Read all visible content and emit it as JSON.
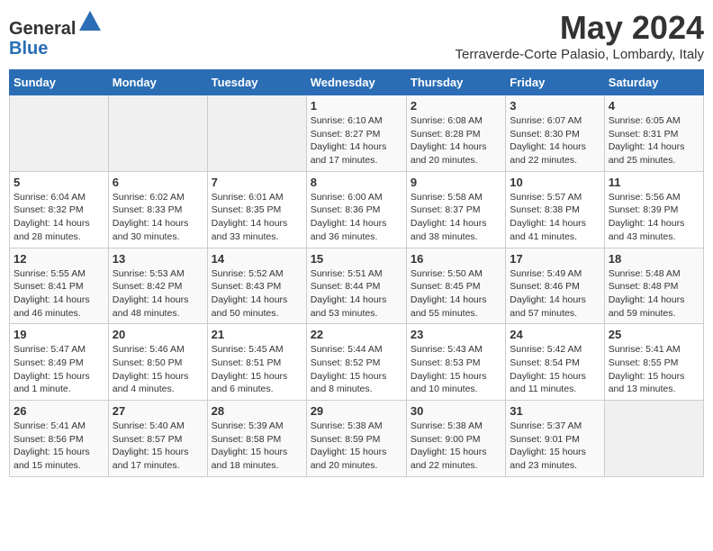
{
  "header": {
    "logo_line1": "General",
    "logo_line2": "Blue",
    "month_title": "May 2024",
    "subtitle": "Terraverde-Corte Palasio, Lombardy, Italy"
  },
  "weekdays": [
    "Sunday",
    "Monday",
    "Tuesday",
    "Wednesday",
    "Thursday",
    "Friday",
    "Saturday"
  ],
  "weeks": [
    [
      {
        "day": "",
        "info": ""
      },
      {
        "day": "",
        "info": ""
      },
      {
        "day": "",
        "info": ""
      },
      {
        "day": "1",
        "info": "Sunrise: 6:10 AM\nSunset: 8:27 PM\nDaylight: 14 hours and 17 minutes."
      },
      {
        "day": "2",
        "info": "Sunrise: 6:08 AM\nSunset: 8:28 PM\nDaylight: 14 hours and 20 minutes."
      },
      {
        "day": "3",
        "info": "Sunrise: 6:07 AM\nSunset: 8:30 PM\nDaylight: 14 hours and 22 minutes."
      },
      {
        "day": "4",
        "info": "Sunrise: 6:05 AM\nSunset: 8:31 PM\nDaylight: 14 hours and 25 minutes."
      }
    ],
    [
      {
        "day": "5",
        "info": "Sunrise: 6:04 AM\nSunset: 8:32 PM\nDaylight: 14 hours and 28 minutes."
      },
      {
        "day": "6",
        "info": "Sunrise: 6:02 AM\nSunset: 8:33 PM\nDaylight: 14 hours and 30 minutes."
      },
      {
        "day": "7",
        "info": "Sunrise: 6:01 AM\nSunset: 8:35 PM\nDaylight: 14 hours and 33 minutes."
      },
      {
        "day": "8",
        "info": "Sunrise: 6:00 AM\nSunset: 8:36 PM\nDaylight: 14 hours and 36 minutes."
      },
      {
        "day": "9",
        "info": "Sunrise: 5:58 AM\nSunset: 8:37 PM\nDaylight: 14 hours and 38 minutes."
      },
      {
        "day": "10",
        "info": "Sunrise: 5:57 AM\nSunset: 8:38 PM\nDaylight: 14 hours and 41 minutes."
      },
      {
        "day": "11",
        "info": "Sunrise: 5:56 AM\nSunset: 8:39 PM\nDaylight: 14 hours and 43 minutes."
      }
    ],
    [
      {
        "day": "12",
        "info": "Sunrise: 5:55 AM\nSunset: 8:41 PM\nDaylight: 14 hours and 46 minutes."
      },
      {
        "day": "13",
        "info": "Sunrise: 5:53 AM\nSunset: 8:42 PM\nDaylight: 14 hours and 48 minutes."
      },
      {
        "day": "14",
        "info": "Sunrise: 5:52 AM\nSunset: 8:43 PM\nDaylight: 14 hours and 50 minutes."
      },
      {
        "day": "15",
        "info": "Sunrise: 5:51 AM\nSunset: 8:44 PM\nDaylight: 14 hours and 53 minutes."
      },
      {
        "day": "16",
        "info": "Sunrise: 5:50 AM\nSunset: 8:45 PM\nDaylight: 14 hours and 55 minutes."
      },
      {
        "day": "17",
        "info": "Sunrise: 5:49 AM\nSunset: 8:46 PM\nDaylight: 14 hours and 57 minutes."
      },
      {
        "day": "18",
        "info": "Sunrise: 5:48 AM\nSunset: 8:48 PM\nDaylight: 14 hours and 59 minutes."
      }
    ],
    [
      {
        "day": "19",
        "info": "Sunrise: 5:47 AM\nSunset: 8:49 PM\nDaylight: 15 hours and 1 minute."
      },
      {
        "day": "20",
        "info": "Sunrise: 5:46 AM\nSunset: 8:50 PM\nDaylight: 15 hours and 4 minutes."
      },
      {
        "day": "21",
        "info": "Sunrise: 5:45 AM\nSunset: 8:51 PM\nDaylight: 15 hours and 6 minutes."
      },
      {
        "day": "22",
        "info": "Sunrise: 5:44 AM\nSunset: 8:52 PM\nDaylight: 15 hours and 8 minutes."
      },
      {
        "day": "23",
        "info": "Sunrise: 5:43 AM\nSunset: 8:53 PM\nDaylight: 15 hours and 10 minutes."
      },
      {
        "day": "24",
        "info": "Sunrise: 5:42 AM\nSunset: 8:54 PM\nDaylight: 15 hours and 11 minutes."
      },
      {
        "day": "25",
        "info": "Sunrise: 5:41 AM\nSunset: 8:55 PM\nDaylight: 15 hours and 13 minutes."
      }
    ],
    [
      {
        "day": "26",
        "info": "Sunrise: 5:41 AM\nSunset: 8:56 PM\nDaylight: 15 hours and 15 minutes."
      },
      {
        "day": "27",
        "info": "Sunrise: 5:40 AM\nSunset: 8:57 PM\nDaylight: 15 hours and 17 minutes."
      },
      {
        "day": "28",
        "info": "Sunrise: 5:39 AM\nSunset: 8:58 PM\nDaylight: 15 hours and 18 minutes."
      },
      {
        "day": "29",
        "info": "Sunrise: 5:38 AM\nSunset: 8:59 PM\nDaylight: 15 hours and 20 minutes."
      },
      {
        "day": "30",
        "info": "Sunrise: 5:38 AM\nSunset: 9:00 PM\nDaylight: 15 hours and 22 minutes."
      },
      {
        "day": "31",
        "info": "Sunrise: 5:37 AM\nSunset: 9:01 PM\nDaylight: 15 hours and 23 minutes."
      },
      {
        "day": "",
        "info": ""
      }
    ]
  ]
}
